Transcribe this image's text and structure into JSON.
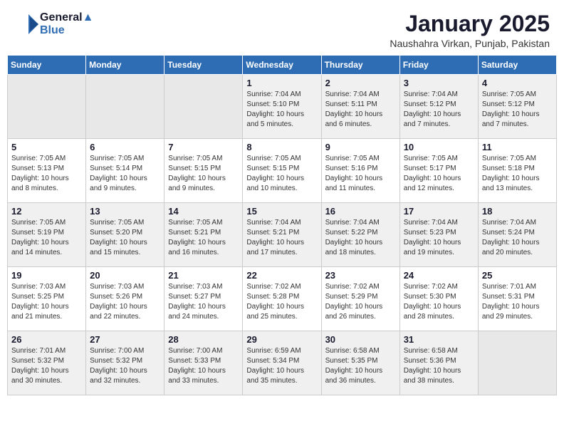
{
  "logo": {
    "line1": "General",
    "line2": "Blue"
  },
  "title": "January 2025",
  "location": "Naushahra Virkan, Punjab, Pakistan",
  "weekdays": [
    "Sunday",
    "Monday",
    "Tuesday",
    "Wednesday",
    "Thursday",
    "Friday",
    "Saturday"
  ],
  "weeks": [
    [
      {
        "day": "",
        "info": ""
      },
      {
        "day": "",
        "info": ""
      },
      {
        "day": "",
        "info": ""
      },
      {
        "day": "1",
        "info": "Sunrise: 7:04 AM\nSunset: 5:10 PM\nDaylight: 10 hours\nand 5 minutes."
      },
      {
        "day": "2",
        "info": "Sunrise: 7:04 AM\nSunset: 5:11 PM\nDaylight: 10 hours\nand 6 minutes."
      },
      {
        "day": "3",
        "info": "Sunrise: 7:04 AM\nSunset: 5:12 PM\nDaylight: 10 hours\nand 7 minutes."
      },
      {
        "day": "4",
        "info": "Sunrise: 7:05 AM\nSunset: 5:12 PM\nDaylight: 10 hours\nand 7 minutes."
      }
    ],
    [
      {
        "day": "5",
        "info": "Sunrise: 7:05 AM\nSunset: 5:13 PM\nDaylight: 10 hours\nand 8 minutes."
      },
      {
        "day": "6",
        "info": "Sunrise: 7:05 AM\nSunset: 5:14 PM\nDaylight: 10 hours\nand 9 minutes."
      },
      {
        "day": "7",
        "info": "Sunrise: 7:05 AM\nSunset: 5:15 PM\nDaylight: 10 hours\nand 9 minutes."
      },
      {
        "day": "8",
        "info": "Sunrise: 7:05 AM\nSunset: 5:15 PM\nDaylight: 10 hours\nand 10 minutes."
      },
      {
        "day": "9",
        "info": "Sunrise: 7:05 AM\nSunset: 5:16 PM\nDaylight: 10 hours\nand 11 minutes."
      },
      {
        "day": "10",
        "info": "Sunrise: 7:05 AM\nSunset: 5:17 PM\nDaylight: 10 hours\nand 12 minutes."
      },
      {
        "day": "11",
        "info": "Sunrise: 7:05 AM\nSunset: 5:18 PM\nDaylight: 10 hours\nand 13 minutes."
      }
    ],
    [
      {
        "day": "12",
        "info": "Sunrise: 7:05 AM\nSunset: 5:19 PM\nDaylight: 10 hours\nand 14 minutes."
      },
      {
        "day": "13",
        "info": "Sunrise: 7:05 AM\nSunset: 5:20 PM\nDaylight: 10 hours\nand 15 minutes."
      },
      {
        "day": "14",
        "info": "Sunrise: 7:05 AM\nSunset: 5:21 PM\nDaylight: 10 hours\nand 16 minutes."
      },
      {
        "day": "15",
        "info": "Sunrise: 7:04 AM\nSunset: 5:21 PM\nDaylight: 10 hours\nand 17 minutes."
      },
      {
        "day": "16",
        "info": "Sunrise: 7:04 AM\nSunset: 5:22 PM\nDaylight: 10 hours\nand 18 minutes."
      },
      {
        "day": "17",
        "info": "Sunrise: 7:04 AM\nSunset: 5:23 PM\nDaylight: 10 hours\nand 19 minutes."
      },
      {
        "day": "18",
        "info": "Sunrise: 7:04 AM\nSunset: 5:24 PM\nDaylight: 10 hours\nand 20 minutes."
      }
    ],
    [
      {
        "day": "19",
        "info": "Sunrise: 7:03 AM\nSunset: 5:25 PM\nDaylight: 10 hours\nand 21 minutes."
      },
      {
        "day": "20",
        "info": "Sunrise: 7:03 AM\nSunset: 5:26 PM\nDaylight: 10 hours\nand 22 minutes."
      },
      {
        "day": "21",
        "info": "Sunrise: 7:03 AM\nSunset: 5:27 PM\nDaylight: 10 hours\nand 24 minutes."
      },
      {
        "day": "22",
        "info": "Sunrise: 7:02 AM\nSunset: 5:28 PM\nDaylight: 10 hours\nand 25 minutes."
      },
      {
        "day": "23",
        "info": "Sunrise: 7:02 AM\nSunset: 5:29 PM\nDaylight: 10 hours\nand 26 minutes."
      },
      {
        "day": "24",
        "info": "Sunrise: 7:02 AM\nSunset: 5:30 PM\nDaylight: 10 hours\nand 28 minutes."
      },
      {
        "day": "25",
        "info": "Sunrise: 7:01 AM\nSunset: 5:31 PM\nDaylight: 10 hours\nand 29 minutes."
      }
    ],
    [
      {
        "day": "26",
        "info": "Sunrise: 7:01 AM\nSunset: 5:32 PM\nDaylight: 10 hours\nand 30 minutes."
      },
      {
        "day": "27",
        "info": "Sunrise: 7:00 AM\nSunset: 5:32 PM\nDaylight: 10 hours\nand 32 minutes."
      },
      {
        "day": "28",
        "info": "Sunrise: 7:00 AM\nSunset: 5:33 PM\nDaylight: 10 hours\nand 33 minutes."
      },
      {
        "day": "29",
        "info": "Sunrise: 6:59 AM\nSunset: 5:34 PM\nDaylight: 10 hours\nand 35 minutes."
      },
      {
        "day": "30",
        "info": "Sunrise: 6:58 AM\nSunset: 5:35 PM\nDaylight: 10 hours\nand 36 minutes."
      },
      {
        "day": "31",
        "info": "Sunrise: 6:58 AM\nSunset: 5:36 PM\nDaylight: 10 hours\nand 38 minutes."
      },
      {
        "day": "",
        "info": ""
      }
    ]
  ]
}
